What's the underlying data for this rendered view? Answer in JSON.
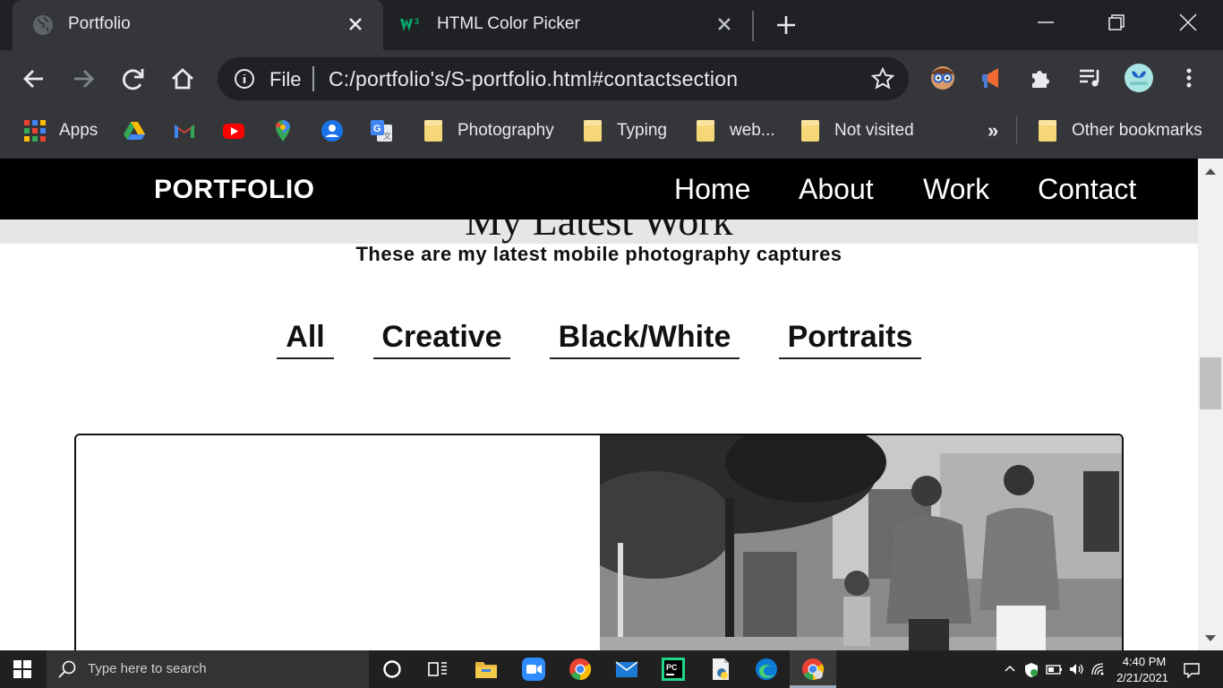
{
  "browser": {
    "tabs": [
      {
        "title": "Portfolio",
        "active": true
      },
      {
        "title": "HTML Color Picker",
        "active": false
      }
    ],
    "omnibox": {
      "scheme_label": "File",
      "url": "C:/portfolio's/S-portfolio.html#contactsection"
    },
    "bookmarks": [
      {
        "label": "Apps",
        "icon": "apps-grid-icon"
      },
      {
        "label": "",
        "icon": "google-drive-icon"
      },
      {
        "label": "",
        "icon": "gmail-icon"
      },
      {
        "label": "",
        "icon": "youtube-icon"
      },
      {
        "label": "",
        "icon": "google-maps-icon"
      },
      {
        "label": "",
        "icon": "contacts-icon"
      },
      {
        "label": "",
        "icon": "google-translate-icon"
      },
      {
        "label": "Photography",
        "icon": "folder-icon"
      },
      {
        "label": "Typing",
        "icon": "folder-icon"
      },
      {
        "label": "web...",
        "icon": "folder-icon"
      },
      {
        "label": "Not visited",
        "icon": "folder-icon"
      }
    ],
    "other_bookmarks": "Other bookmarks",
    "overflow": "»"
  },
  "page": {
    "nav": {
      "brand": "PORTFOLIO",
      "links": [
        "Home",
        "About",
        "Work",
        "Contact"
      ]
    },
    "section_title": "My Latest Work",
    "subtitle": "These are my latest mobile photography captures",
    "filters": [
      "All",
      "Creative",
      "Black/White",
      "Portraits"
    ]
  },
  "taskbar": {
    "search_placeholder": "Type here to search",
    "time": "4:40 PM",
    "date": "2/21/2021"
  },
  "colors": {
    "chrome_dark": "#202124",
    "chrome_toolbar": "#35363a",
    "navbar": "#000000",
    "folder_yellow": "#f6d777"
  }
}
